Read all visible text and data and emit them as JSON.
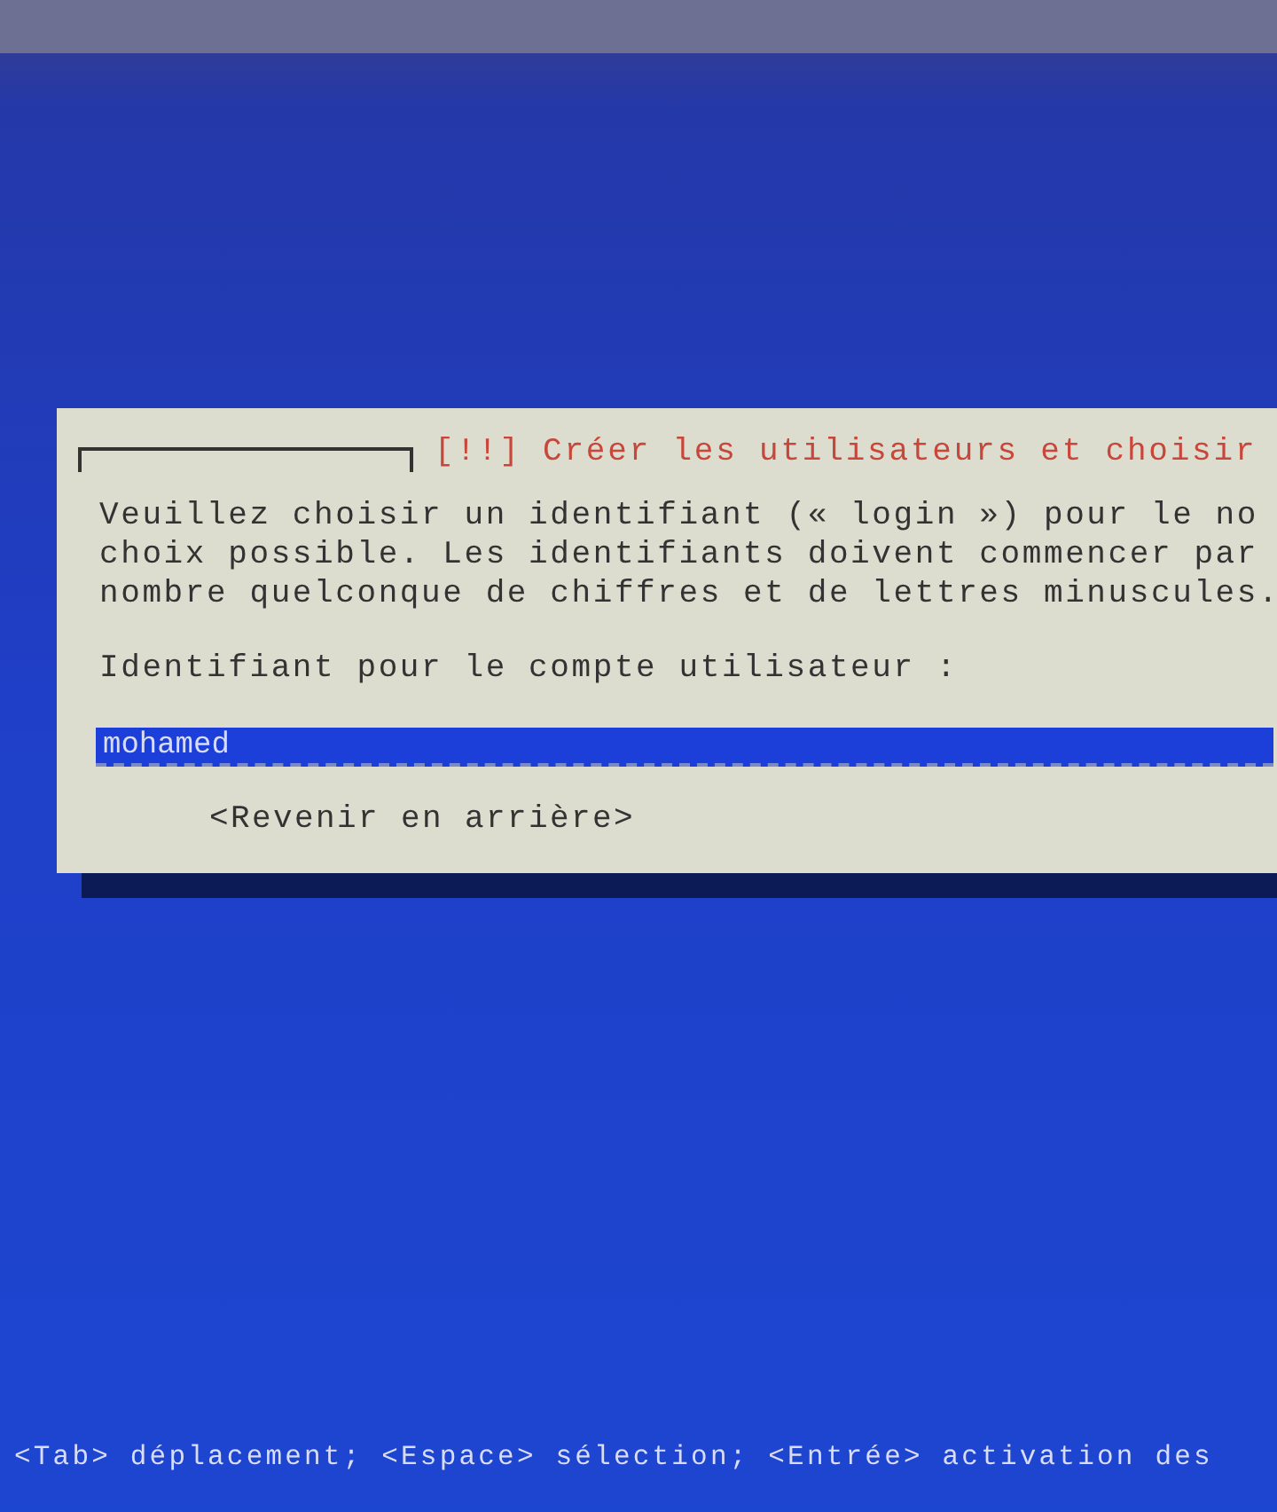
{
  "dialog": {
    "title": "[!!] Créer les utilisateurs et choisir",
    "message_lines": [
      "Veuillez choisir un identifiant (« login ») pour le no",
      "choix possible. Les identifiants doivent commencer par",
      "nombre quelconque de chiffres et de lettres minuscules."
    ],
    "field_label": "Identifiant pour le compte utilisateur :",
    "field": {
      "value": "mohamed"
    },
    "buttons": [
      "<Revenir en arrière>"
    ]
  },
  "status_bar": "<Tab> déplacement; <Espace> sélection; <Entrée> activation des"
}
